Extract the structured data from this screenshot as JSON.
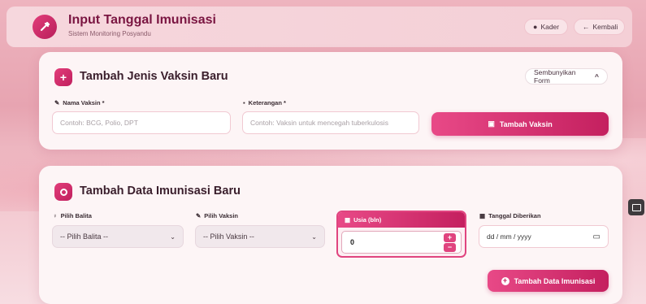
{
  "header": {
    "title": "Input Tanggal Imunisasi",
    "subtitle": "Sistem Monitoring Posyandu",
    "kader_label": "Kader",
    "kembali_label": "Kembali"
  },
  "vaksin_card": {
    "title": "Tambah Jenis Vaksin Baru",
    "toggle_label": "Sembunyikan Form",
    "nama_label": "Nama Vaksin *",
    "nama_placeholder": "Contoh: BCG, Polio, DPT",
    "ket_label": "Keterangan *",
    "ket_placeholder": "Contoh: Vaksin untuk mencegah tuberkulosis",
    "submit_label": "Tambah Vaksin"
  },
  "imunisasi_card": {
    "title": "Tambah Data Imunisasi Baru",
    "balita_label": "Pilih Balita",
    "balita_value": "-- Pilih Balita --",
    "vaksin_label": "Pilih Vaksin",
    "vaksin_value": "-- Pilih Vaksin --",
    "usia_label": "Usia (bln)",
    "usia_value": "0",
    "tanggal_label": "Tanggal Diberikan",
    "tanggal_value": "dd / mm / yyyy",
    "submit_label": "Tambah Data Imunisasi"
  },
  "colors": {
    "accent": "#e23d7a",
    "accent_dark": "#c4205f",
    "title_text": "#7a1541"
  },
  "icons": [
    "syringe-icon",
    "user-circle-icon",
    "arrow-left-icon",
    "plus-icon",
    "chevron-up-icon",
    "pencil-icon",
    "document-icon",
    "save-icon",
    "circle-dot-icon",
    "baby-icon",
    "calendar-icon",
    "chevron-down-icon",
    "plus-circle-icon",
    "screenshot-icon"
  ]
}
